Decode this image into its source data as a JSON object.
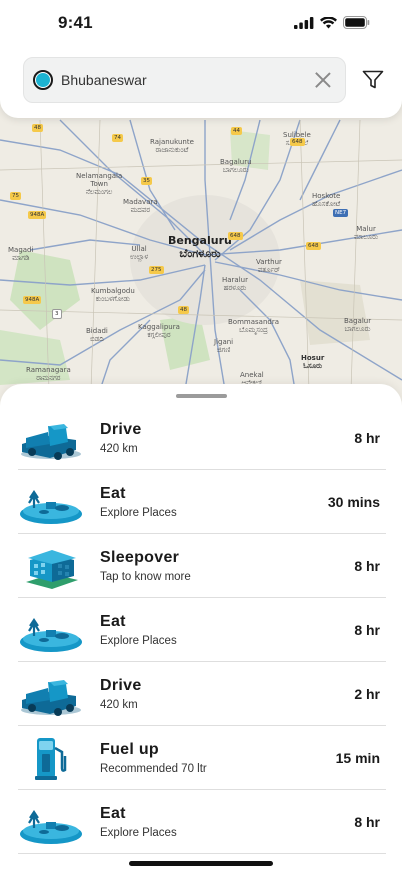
{
  "status_bar": {
    "time": "9:41"
  },
  "search": {
    "location": "Bhubaneswar"
  },
  "map": {
    "labels": [
      {
        "id": "rajanukunte",
        "text": "Rajanukunte\nರಾಜಾನುಕುಂಟೆ"
      },
      {
        "id": "sulibele",
        "text": "Sulibele\nಸೂಲಿಬೆಲೆ"
      },
      {
        "id": "nelamangala",
        "text": "Nelamangala\nTown\nನೆಲಮಂಗಲ"
      },
      {
        "id": "bagaluru",
        "text": "Bagaluru\nಬಾಗಲೂರು"
      },
      {
        "id": "madavara",
        "text": "Madavara\nಮದವರ"
      },
      {
        "id": "hoskote",
        "text": "Hoskote\nಹೊಸಕೋಟೆ"
      },
      {
        "id": "bengaluru",
        "text": "Bengaluru\nಬೆಂಗಳೂರು"
      },
      {
        "id": "magadi",
        "text": "Magadi\nಮಾಗಡಿ"
      },
      {
        "id": "ullal",
        "text": "Ullal\nಉಲ್ಲಾಳ"
      },
      {
        "id": "malur",
        "text": "Malur\nಮಾಲೂರು"
      },
      {
        "id": "varthur",
        "text": "Varthur\nವರ್ತೂರ್"
      },
      {
        "id": "kumbalgodu",
        "text": "Kumbalgodu\nಕುಂಬಳಗೋಡು"
      },
      {
        "id": "haralur",
        "text": "Haralur\nಹರಳೂರು"
      },
      {
        "id": "bidadi",
        "text": "Bidadi\nಬಿಡದಿ"
      },
      {
        "id": "kaggalipura",
        "text": "Kaggalipura\nಕಗ್ಗಲೀಪುರ"
      },
      {
        "id": "bommasandra",
        "text": "Bommasandra\nಬೊಮ್ಮಸಂದ್ರ"
      },
      {
        "id": "bagalur2",
        "text": "Bagalur\nಬಾಗಲೂರು"
      },
      {
        "id": "jigani",
        "text": "Jigani\nಜಿಗಣಿ"
      },
      {
        "id": "ramanagara",
        "text": "Ramanagara\nರಾಮನಗರ"
      },
      {
        "id": "hosur",
        "text": "Hosur\nಓಸೂರು"
      },
      {
        "id": "anekal",
        "text": "Anekal\nಆನೇಕಲ್"
      }
    ],
    "shields": [
      "48",
      "74",
      "44",
      "648",
      "35",
      "75",
      "948A",
      "NE7",
      "648",
      "275",
      "648",
      "948A",
      "3",
      "48"
    ]
  },
  "itinerary": [
    {
      "title": "Drive",
      "subtitle": "420 km",
      "duration": "8 hr",
      "icon": "truck-icon"
    },
    {
      "title": "Eat",
      "subtitle": "Explore Places",
      "duration": "30 mins",
      "icon": "food-plaza-icon"
    },
    {
      "title": "Sleepover",
      "subtitle": "Tap to know more",
      "duration": "8 hr",
      "icon": "hotel-icon"
    },
    {
      "title": "Eat",
      "subtitle": "Explore Places",
      "duration": "8 hr",
      "icon": "food-plaza-icon"
    },
    {
      "title": "Drive",
      "subtitle": "420 km",
      "duration": "2 hr",
      "icon": "truck-icon"
    },
    {
      "title": "Fuel up",
      "subtitle": "Recommended 70 ltr",
      "duration": "15 min",
      "icon": "fuel-pump-icon"
    },
    {
      "title": "Eat",
      "subtitle": "Explore Places",
      "duration": "8 hr",
      "icon": "food-plaza-icon"
    }
  ],
  "colors": {
    "accent": "#1cb3d1",
    "icon_blue": "#1597c7",
    "icon_dark": "#0e5f87"
  }
}
